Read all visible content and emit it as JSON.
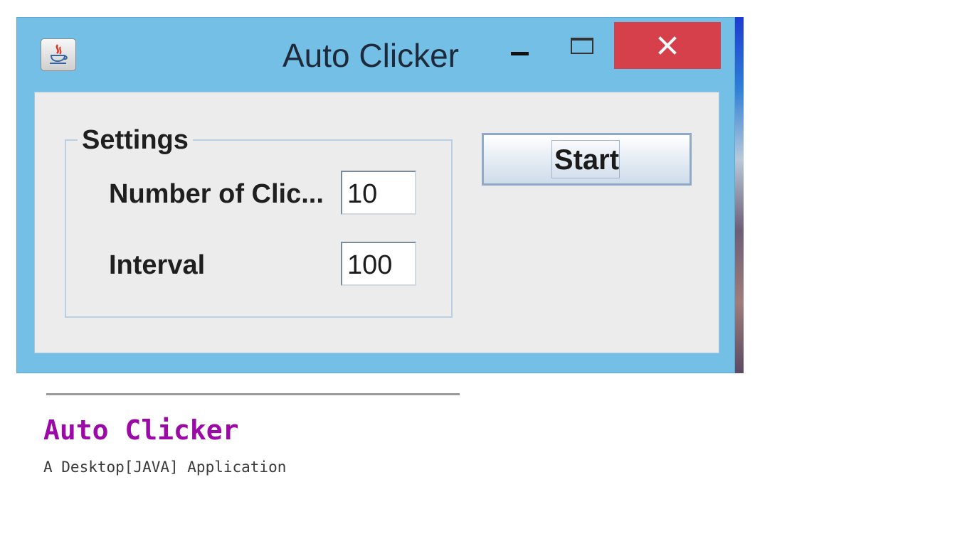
{
  "window": {
    "title": "Auto Clicker",
    "icon": "java-cup-icon",
    "controls": {
      "minimize": "minimize-icon",
      "maximize": "maximize-icon",
      "close": "close-icon"
    },
    "colors": {
      "titlebar": "#74bfe6",
      "close": "#d6404a",
      "content": "#ececec"
    }
  },
  "settings": {
    "legend": "Settings",
    "clicks_label": "Number of Clic...",
    "clicks_value": "10",
    "interval_label": "Interval",
    "interval_value": "100"
  },
  "actions": {
    "start_label": "Start"
  },
  "caption": {
    "title": "Auto Clicker",
    "subtitle": "A Desktop[JAVA] Application",
    "title_color": "#9b0aa6"
  }
}
